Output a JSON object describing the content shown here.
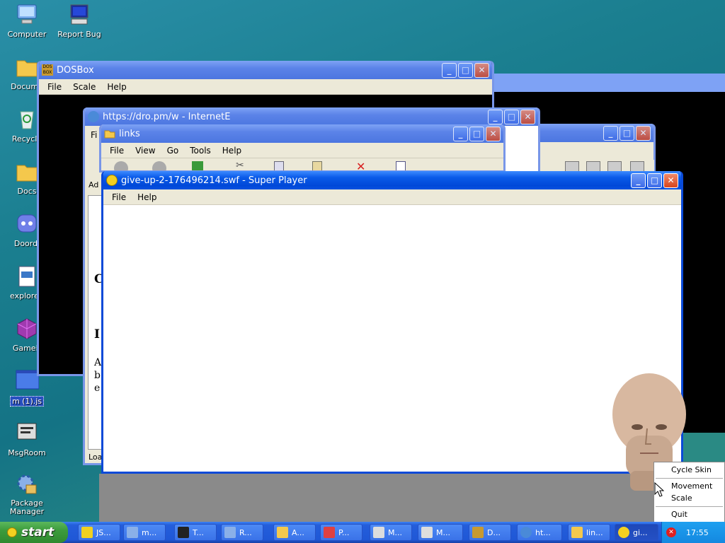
{
  "desktop": {
    "icons": [
      {
        "label": "Computer"
      },
      {
        "label": "Report Bug"
      },
      {
        "label": "Docume"
      },
      {
        "label": "Recycle"
      },
      {
        "label": "Docs"
      },
      {
        "label": "Doordi"
      },
      {
        "label": "explorer."
      },
      {
        "label": "Gameir"
      },
      {
        "label": "m (1).js"
      },
      {
        "label": "MsgRoom"
      },
      {
        "label": "Package Manager"
      }
    ]
  },
  "windows": {
    "dosbox": {
      "title": "DOSBox",
      "menu": [
        "File",
        "Scale",
        "Help"
      ]
    },
    "ie": {
      "title": "https://dro.pm/w - InternetE",
      "menu_first": "Fi",
      "addr": "Ad",
      "status": "Loa",
      "frag": [
        "C",
        "I",
        "A",
        "b",
        "e"
      ]
    },
    "links": {
      "title": "links",
      "menu": [
        "File",
        "View",
        "Go",
        "Tools",
        "Help"
      ]
    },
    "player": {
      "title": "give-up-2-176496214.swf - Super Player",
      "menu": [
        "File",
        "Help"
      ]
    }
  },
  "context_menu": {
    "items": [
      "Cycle Skin",
      "Movement",
      "Scale",
      "Quit"
    ]
  },
  "taskbar": {
    "start": "start",
    "items": [
      {
        "label": "JS..."
      },
      {
        "label": "m..."
      },
      {
        "label": "T..."
      },
      {
        "label": "R..."
      },
      {
        "label": "A..."
      },
      {
        "label": "P..."
      },
      {
        "label": "M..."
      },
      {
        "label": "M..."
      },
      {
        "label": "D..."
      },
      {
        "label": "ht..."
      },
      {
        "label": "lin..."
      },
      {
        "label": "gi..."
      }
    ],
    "clock": "17:55"
  },
  "colors": {
    "accent": "#0a5ae8",
    "start": "#3c9c3c"
  }
}
